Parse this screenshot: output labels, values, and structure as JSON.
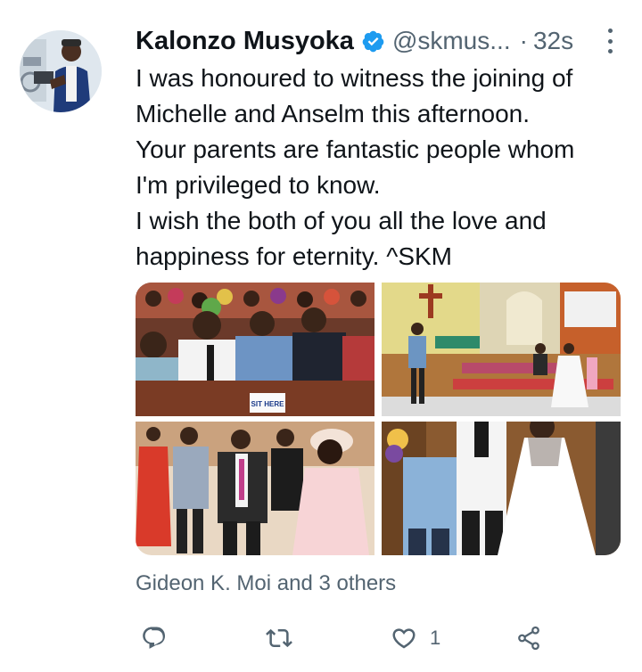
{
  "tweet": {
    "author_name": "Kalonzo Musyoka",
    "handle": "@skmus...",
    "separator": "·",
    "time": "32s",
    "text_lines": [
      "I was honoured to witness the joining of",
      "Michelle and Anselm this afternoon.",
      "Your parents are fantastic people whom",
      "I'm privileged to know.",
      "I wish the both of you all the love and",
      "happiness for eternity. ^SKM"
    ],
    "photo1_sign_text": "SIT HERE",
    "liked_by": "Gideon K. Moi and 3 others",
    "like_count": "1"
  },
  "colors": {
    "accent": "#1d9bf0",
    "secondary_text": "#536471",
    "primary_text": "#0f1419"
  },
  "icons": [
    "verified-badge-icon",
    "more-options-icon",
    "reply-icon",
    "retweet-icon",
    "like-icon",
    "share-icon"
  ]
}
